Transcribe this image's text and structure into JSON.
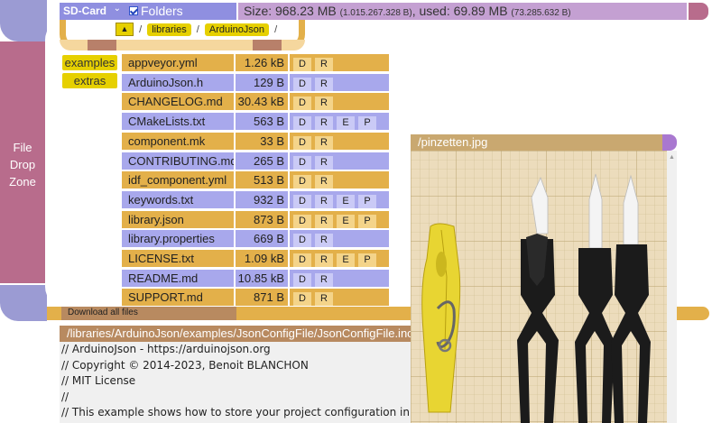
{
  "header": {
    "storage_select": "SD-Card",
    "folders_label": "Folders",
    "size_text": "Size: 968.23 MB",
    "size_bytes": "(1.015.267.328 B)",
    "used_text": ", used: 69.89 MB",
    "used_bytes": "(73.285.632 B)"
  },
  "drop_zone": {
    "line1": "File",
    "line2": "Drop",
    "line3": "Zone"
  },
  "breadcrumb": {
    "up_label": "▲",
    "sep": "/",
    "items": [
      "libraries",
      "ArduinoJson"
    ]
  },
  "folders": [
    "examples",
    "extras"
  ],
  "files": [
    {
      "name": "appveyor.yml",
      "size": "1.26 kB",
      "actions": [
        "D",
        "R"
      ]
    },
    {
      "name": "ArduinoJson.h",
      "size": "129 B",
      "actions": [
        "D",
        "R"
      ]
    },
    {
      "name": "CHANGELOG.md",
      "size": "30.43 kB",
      "actions": [
        "D",
        "R"
      ]
    },
    {
      "name": "CMakeLists.txt",
      "size": "563 B",
      "actions": [
        "D",
        "R",
        "E",
        "P"
      ]
    },
    {
      "name": "component.mk",
      "size": "33 B",
      "actions": [
        "D",
        "R"
      ]
    },
    {
      "name": "CONTRIBUTING.md",
      "size": "265 B",
      "actions": [
        "D",
        "R"
      ]
    },
    {
      "name": "idf_component.yml",
      "size": "513 B",
      "actions": [
        "D",
        "R"
      ]
    },
    {
      "name": "keywords.txt",
      "size": "932 B",
      "actions": [
        "D",
        "R",
        "E",
        "P"
      ]
    },
    {
      "name": "library.json",
      "size": "873 B",
      "actions": [
        "D",
        "R",
        "E",
        "P"
      ]
    },
    {
      "name": "library.properties",
      "size": "669 B",
      "actions": [
        "D",
        "R"
      ]
    },
    {
      "name": "LICENSE.txt",
      "size": "1.09 kB",
      "actions": [
        "D",
        "R",
        "E",
        "P"
      ]
    },
    {
      "name": "README.md",
      "size": "10.85 kB",
      "actions": [
        "D",
        "R"
      ]
    },
    {
      "name": "SUPPORT.md",
      "size": "871 B",
      "actions": [
        "D",
        "R"
      ]
    }
  ],
  "download_all": "Download all files",
  "text_viewer": {
    "title": "/libraries/ArduinoJson/examples/JsonConfigFile/JsonConfigFile.ino",
    "lines": [
      "// ArduinoJson - https://arduinojson.org",
      "// Copyright © 2014-2023, Benoit BLANCHON",
      "// MIT License",
      "//",
      "// This example shows how to store your project configuration in a file."
    ]
  },
  "image_viewer": {
    "title": "/pinzetten.jpg"
  },
  "colors": {
    "purple": "#9b9bd3",
    "mauve": "#b86c8c",
    "orange": "#e3b04a",
    "lavender": "#a8a8ec",
    "yellow": "#e6d000"
  }
}
